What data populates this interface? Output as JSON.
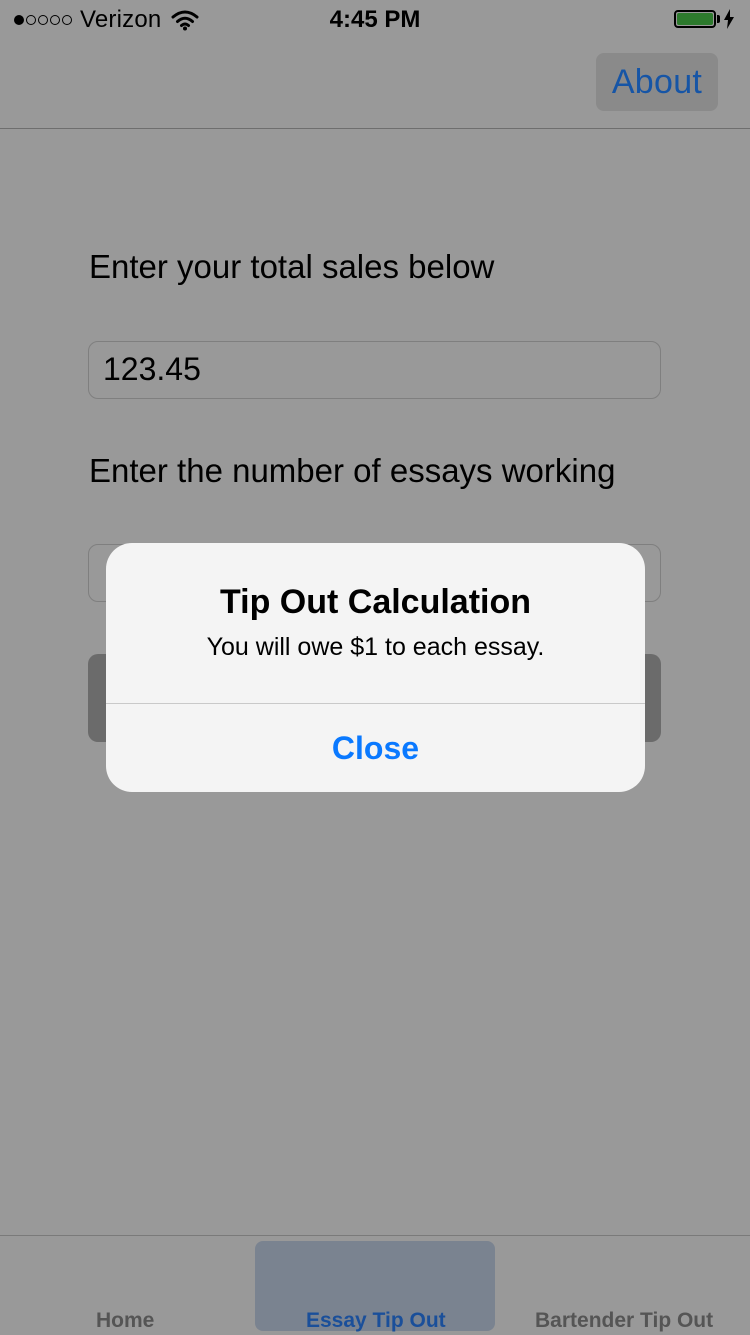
{
  "status_bar": {
    "carrier": "Verizon",
    "signal_bars_filled": 1,
    "signal_bars_total": 5,
    "time": "4:45 PM",
    "battery_level": 1.0
  },
  "nav": {
    "about_label": "About"
  },
  "form": {
    "sales_label": "Enter your total sales below",
    "sales_value": "123.45",
    "essays_label": "Enter the number of essays working"
  },
  "alert": {
    "title": "Tip Out Calculation",
    "message": "You will owe $1 to each essay.",
    "close_label": "Close"
  },
  "tabs": [
    {
      "label": "Home",
      "selected": false
    },
    {
      "label": "Essay Tip Out",
      "selected": true
    },
    {
      "label": "Bartender Tip Out",
      "selected": false
    }
  ],
  "colors": {
    "accent": "#0a79ff",
    "dimmed_background": "#999999",
    "battery": "#2d7a2d"
  }
}
